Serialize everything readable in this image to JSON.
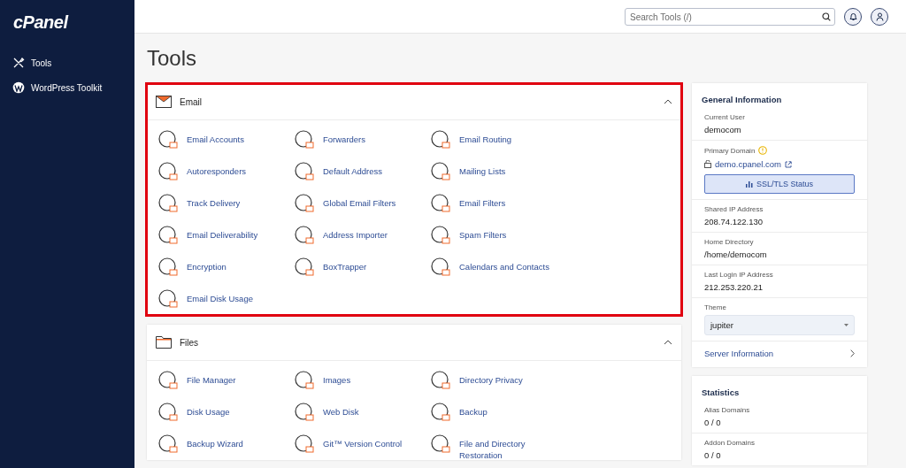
{
  "sidebar": {
    "logo": "cPanel",
    "items": [
      {
        "label": "Tools"
      },
      {
        "label": "WordPress Toolkit"
      }
    ]
  },
  "header": {
    "search": {
      "placeholder": "Search Tools (/)"
    }
  },
  "page_title": "Tools",
  "sections": [
    {
      "title": "Email",
      "expanded": true,
      "highlighted": true,
      "tools": [
        "Email Accounts",
        "Forwarders",
        "Email Routing",
        "Autoresponders",
        "Default Address",
        "Mailing Lists",
        "Track Delivery",
        "Global Email Filters",
        "Email Filters",
        "Email Deliverability",
        "Address Importer",
        "Spam Filters",
        "Encryption",
        "BoxTrapper",
        "Calendars and Contacts",
        "Email Disk Usage"
      ]
    },
    {
      "title": "Files",
      "expanded": true,
      "highlighted": false,
      "tools": [
        "File Manager",
        "Images",
        "Directory Privacy",
        "Disk Usage",
        "Web Disk",
        "Backup",
        "Backup Wizard",
        "Git™ Version Control",
        "File and Directory Restoration"
      ]
    }
  ],
  "general_information": {
    "title": "General Information",
    "current_user": {
      "label": "Current User",
      "value": "democom"
    },
    "primary_domain": {
      "label": "Primary Domain",
      "value": "demo.cpanel.com",
      "button": "SSL/TLS Status"
    },
    "shared_ip": {
      "label": "Shared IP Address",
      "value": "208.74.122.130"
    },
    "home_directory": {
      "label": "Home Directory",
      "value": "/home/democom"
    },
    "last_login_ip": {
      "label": "Last Login IP Address",
      "value": "212.253.220.21"
    },
    "theme": {
      "label": "Theme",
      "value": "jupiter"
    },
    "server_information": "Server Information"
  },
  "statistics": {
    "title": "Statistics",
    "items": [
      {
        "label": "Alias Domains",
        "value": "0 / 0"
      },
      {
        "label": "Addon Domains",
        "value": "0 / 0"
      }
    ]
  }
}
